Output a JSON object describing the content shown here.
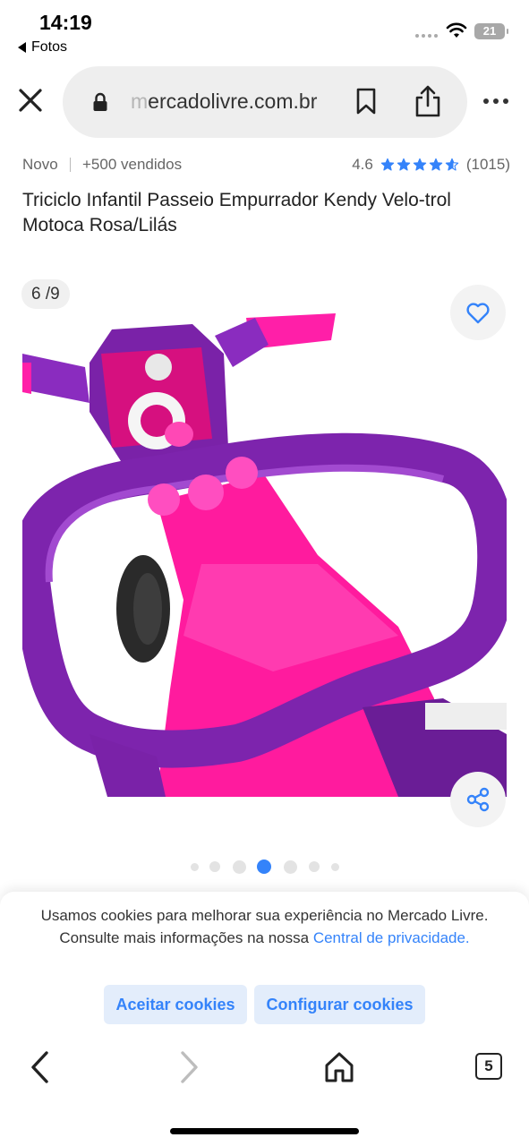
{
  "status_bar": {
    "time": "14:19",
    "back_app": "Fotos",
    "battery": "21"
  },
  "browser": {
    "url_faded": "m",
    "url_visible": "ercadolivre.com.br",
    "tab_count": "5"
  },
  "product": {
    "condition": "Novo",
    "sold": "+500 vendidos",
    "rating": "4.6",
    "stars": 4.6,
    "reviews": "(1015)",
    "title": "Triciclo Infantil Passeio Empurrador Kendy Velo-trol Motoca Rosa/Lilás",
    "gallery_counter": "6 /9"
  },
  "gallery_dots": {
    "count": 7,
    "active_index": 3
  },
  "cookie_banner": {
    "text_prefix": "Usamos cookies para melhorar sua experiência no Mercado Livre. Consulte mais informações na nossa ",
    "link_text": "Central de privacidade.",
    "accept_label": "Aceitar cookies",
    "config_label": "Configurar cookies"
  },
  "colors": {
    "accent_blue": "#3483fa",
    "star_blue": "#3483fa",
    "purple": "#7a22a8",
    "pink": "#ff1aa0"
  },
  "icons": [
    "close-icon",
    "lock-icon",
    "bookmark-icon",
    "share-icon",
    "more-icon",
    "heart-icon",
    "share-nodes-icon",
    "back-icon",
    "forward-icon",
    "home-icon",
    "tabs-icon"
  ]
}
